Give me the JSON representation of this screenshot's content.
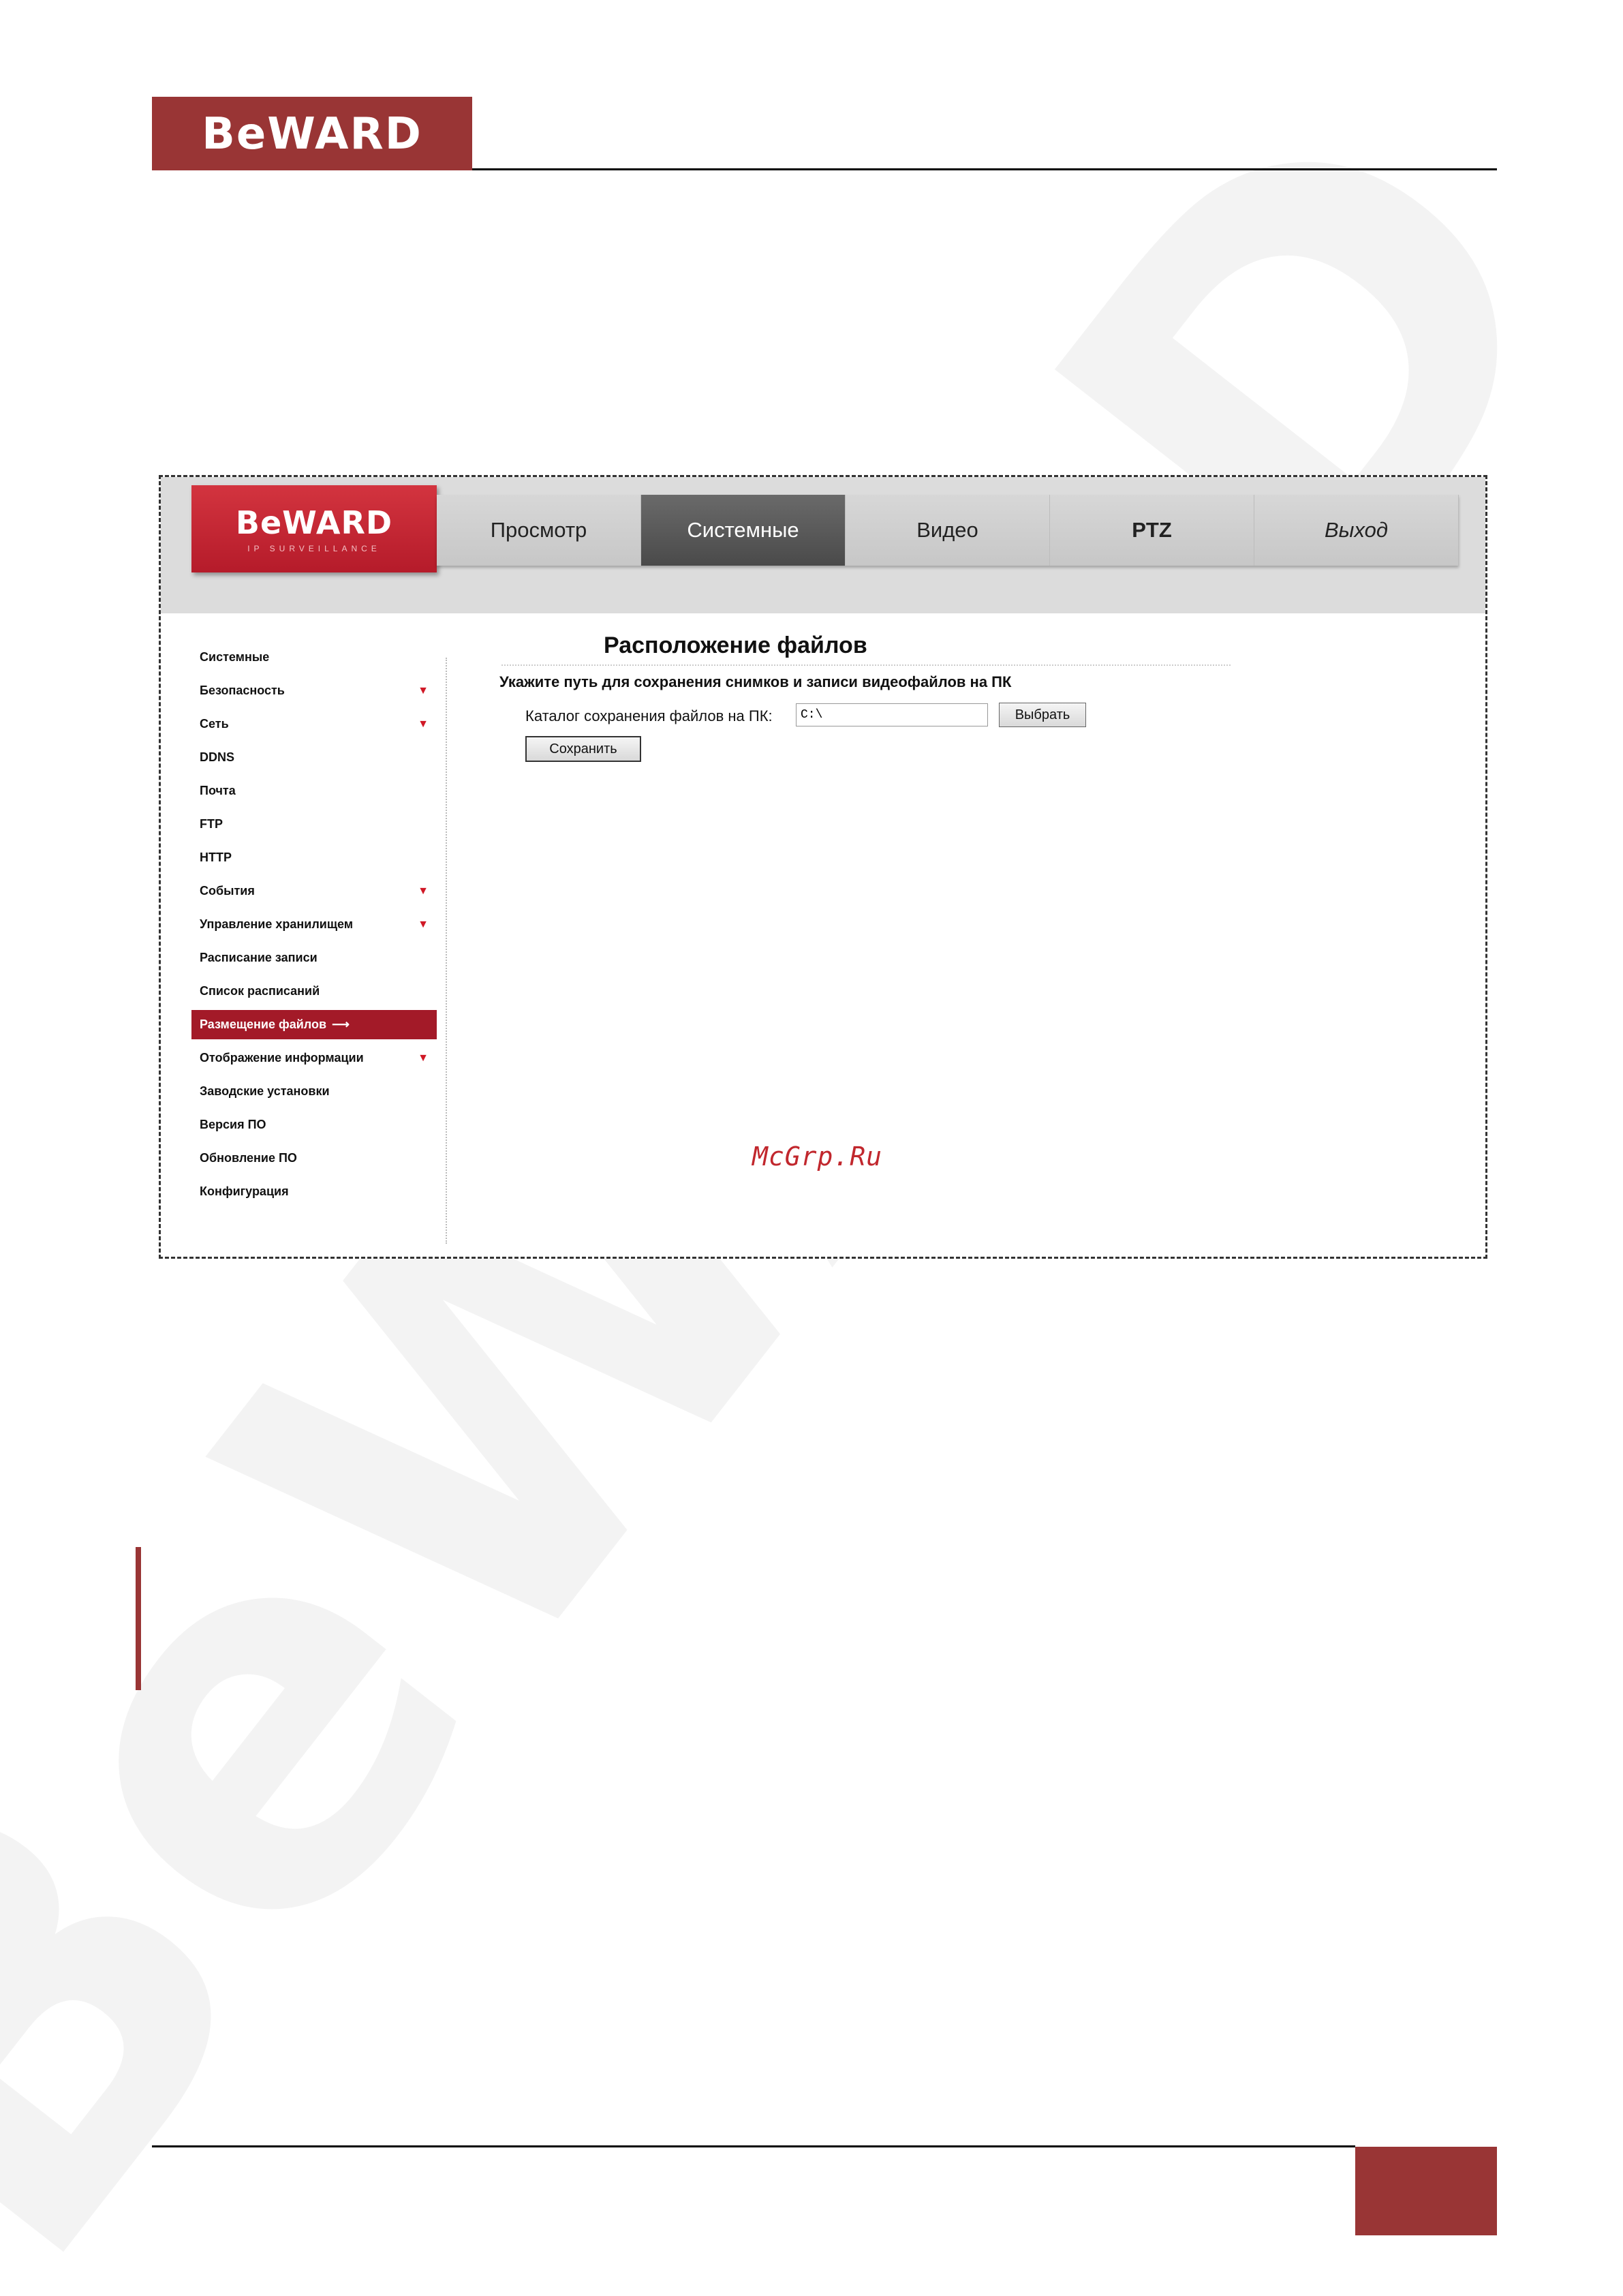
{
  "doc": {
    "logo_text": "BeWARD"
  },
  "app": {
    "logo_text": "BeWARD",
    "logo_subtitle": "IP SURVEILLANCE",
    "nav": {
      "tabs": [
        {
          "label": "Просмотр",
          "active": false
        },
        {
          "label": "Системные",
          "active": true
        },
        {
          "label": "Видео",
          "active": false
        },
        {
          "label": "PTZ",
          "active": false
        },
        {
          "label": "Выход",
          "active": false
        }
      ]
    },
    "sidebar": {
      "items": [
        {
          "label": "Системные",
          "expandable": false
        },
        {
          "label": "Безопасность",
          "expandable": true
        },
        {
          "label": "Сеть",
          "expandable": true
        },
        {
          "label": "DDNS",
          "expandable": false
        },
        {
          "label": "Почта",
          "expandable": false
        },
        {
          "label": "FTP",
          "expandable": false
        },
        {
          "label": "HTTP",
          "expandable": false
        },
        {
          "label": "События",
          "expandable": true
        },
        {
          "label": "Управление хранилищем",
          "expandable": true
        },
        {
          "label": "Расписание записи",
          "expandable": false
        },
        {
          "label": "Список расписаний",
          "expandable": false
        },
        {
          "label": "Размещение файлов",
          "expandable": false,
          "active": true
        },
        {
          "label": "Отображение информации",
          "expandable": true
        },
        {
          "label": "Заводские установки",
          "expandable": false
        },
        {
          "label": "Версия ПО",
          "expandable": false
        },
        {
          "label": "Обновление ПО",
          "expandable": false
        },
        {
          "label": "Конфигурация",
          "expandable": false
        }
      ],
      "active_arrow": "⟶",
      "expand_marker": "▼"
    },
    "content": {
      "title": "Расположение файлов",
      "subheading": "Укажите путь для сохранения снимков и записи видеофайлов на ПК",
      "field_label": "Каталог сохранения файлов на ПК:",
      "path_value": "C:\\",
      "browse_label": "Выбрать",
      "save_label": "Сохранить"
    },
    "watermark_site": "McGrp.Ru"
  },
  "colors": {
    "brand": "#993535",
    "app_red": "#b51b2a",
    "nav_active": "#4a4a4a"
  }
}
